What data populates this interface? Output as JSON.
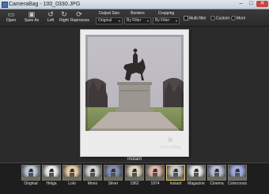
{
  "window": {
    "title": "CameraBag - 100_0330.JPG",
    "controls": {
      "minimize": "–",
      "maximize": "□",
      "close": "✕"
    }
  },
  "toolbar": {
    "buttons": [
      {
        "label": "Open",
        "icon": "folder-icon"
      },
      {
        "label": "Save As",
        "icon": "save-icon"
      },
      {
        "label": "Left",
        "icon": "rotate-left-icon"
      },
      {
        "label": "Right",
        "icon": "rotate-right-icon"
      },
      {
        "label": "Reprocess",
        "icon": "reprocess-icon"
      }
    ],
    "output_size": {
      "label": "Output Size",
      "value": "Original"
    },
    "borders": {
      "label": "Borders",
      "value": "By Filter"
    },
    "cropping": {
      "label": "Cropping",
      "value": "By Filter"
    },
    "multi_filter": {
      "label": "Multi-filter",
      "checked": false
    },
    "custom": {
      "label": "Custom"
    },
    "more": {
      "label": "More"
    }
  },
  "current_effect": "Instant",
  "watermark": "CameraBag",
  "filters": [
    {
      "name": "Original",
      "tint": "#b9c3d6",
      "selected": false
    },
    {
      "name": "Helga",
      "tint": "#e7e7e7",
      "selected": false
    },
    {
      "name": "Lolo",
      "tint": "#e3c9a1",
      "selected": false
    },
    {
      "name": "Mono",
      "tint": "#cfcfcf",
      "selected": false
    },
    {
      "name": "Silver",
      "tint": "#7f8fb0",
      "selected": false
    },
    {
      "name": "1962",
      "tint": "#dcd0b8",
      "selected": false
    },
    {
      "name": "1974",
      "tint": "#dbb3a4",
      "selected": false
    },
    {
      "name": "Instant",
      "tint": "#c6c6c6",
      "selected": true
    },
    {
      "name": "Magazine",
      "tint": "#e0e0e0",
      "selected": false
    },
    {
      "name": "Cinema",
      "tint": "#b3bad4",
      "selected": false
    },
    {
      "name": "Colorcross",
      "tint": "#9ea8df",
      "selected": false
    }
  ],
  "colors": {
    "background": "#2b2b2b",
    "polaroid_frame": "#ececec",
    "selected_border": "#e8c060"
  }
}
